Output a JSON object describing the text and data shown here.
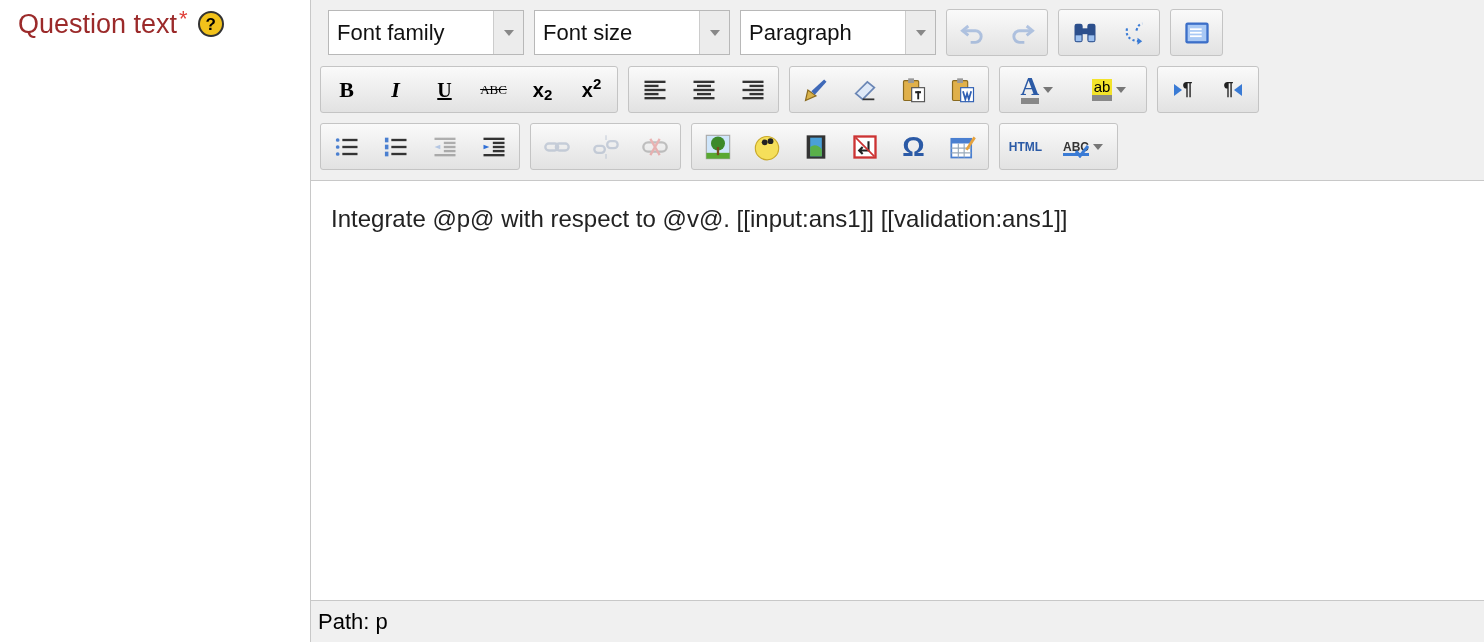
{
  "field": {
    "label": "Question text",
    "required_mark": "*",
    "help": "?"
  },
  "toolbar": {
    "rows": [
      {
        "groups": [
          {
            "kind": "select",
            "label": "Font family"
          },
          {
            "kind": "select",
            "label": "Font size"
          },
          {
            "kind": "select",
            "label": "Paragraph"
          },
          {
            "kind": "buttons",
            "buttons": [
              {
                "kind": "undo",
                "disabled": true
              },
              {
                "kind": "redo",
                "disabled": true
              }
            ]
          },
          {
            "kind": "buttons",
            "buttons": [
              {
                "kind": "find",
                "disabled": false
              },
              {
                "kind": "replace",
                "disabled": false
              }
            ]
          },
          {
            "kind": "buttons",
            "buttons": [
              {
                "kind": "fullscreen",
                "disabled": false
              }
            ]
          }
        ]
      },
      {
        "groups": [
          {
            "kind": "buttons",
            "buttons": [
              {
                "kind": "bold",
                "glyph": "B",
                "disabled": false
              },
              {
                "kind": "italic",
                "glyph": "I",
                "disabled": false
              },
              {
                "kind": "underline",
                "glyph": "U",
                "disabled": false
              },
              {
                "kind": "strike",
                "glyph": "ABC",
                "disabled": false
              },
              {
                "kind": "sub",
                "glyph": "x$_{2}$",
                "disabled": false
              },
              {
                "kind": "sup",
                "glyph": "x$^{2}$",
                "disabled": false
              }
            ]
          },
          {
            "kind": "buttons",
            "buttons": [
              {
                "kind": "alignleft",
                "disabled": false
              },
              {
                "kind": "aligncenter",
                "disabled": false
              },
              {
                "kind": "alignright",
                "disabled": false
              }
            ]
          },
          {
            "kind": "buttons",
            "buttons": [
              {
                "kind": "brush",
                "disabled": false
              },
              {
                "kind": "eraser",
                "disabled": false
              },
              {
                "kind": "pastetext",
                "disabled": false
              },
              {
                "kind": "pasteword",
                "disabled": false
              }
            ]
          },
          {
            "kind": "buttons",
            "buttons": [
              {
                "kind": "forecolor",
                "glyph": "A",
                "disabled": false
              },
              {
                "kind": "backcolor",
                "glyph": "ab",
                "disabled": false
              }
            ]
          },
          {
            "kind": "buttons",
            "buttons": [
              {
                "kind": "ltr",
                "glyph": "¶",
                "disabled": false
              },
              {
                "kind": "rtl",
                "glyph": "¶",
                "disabled": false
              }
            ]
          }
        ]
      },
      {
        "groups": [
          {
            "kind": "buttons",
            "buttons": [
              {
                "kind": "bullist",
                "disabled": false
              },
              {
                "kind": "numlist",
                "disabled": false
              },
              {
                "kind": "outdent",
                "disabled": true
              },
              {
                "kind": "indent",
                "disabled": false
              }
            ]
          },
          {
            "kind": "buttons",
            "buttons": [
              {
                "kind": "link",
                "disabled": true
              },
              {
                "kind": "unlink",
                "disabled": true
              },
              {
                "kind": "anchor",
                "disabled": true
              }
            ]
          },
          {
            "kind": "buttons",
            "buttons": [
              {
                "kind": "image",
                "disabled": false
              },
              {
                "kind": "emoticon",
                "disabled": false
              },
              {
                "kind": "media",
                "disabled": false
              },
              {
                "kind": "nonbreaking",
                "disabled": false
              },
              {
                "kind": "charmap",
                "glyph": "Ω",
                "disabled": false
              },
              {
                "kind": "table",
                "disabled": false
              }
            ]
          },
          {
            "kind": "buttons",
            "buttons": [
              {
                "kind": "code",
                "glyph": "HTML",
                "disabled": false
              },
              {
                "kind": "spellcheck",
                "glyph": "ABC",
                "disabled": false
              }
            ]
          }
        ]
      }
    ]
  },
  "content": "Integrate @p@ with respect to @v@. [[input:ans1]] [[validation:ans1]]",
  "status_bar": {
    "path": "Path: p"
  }
}
